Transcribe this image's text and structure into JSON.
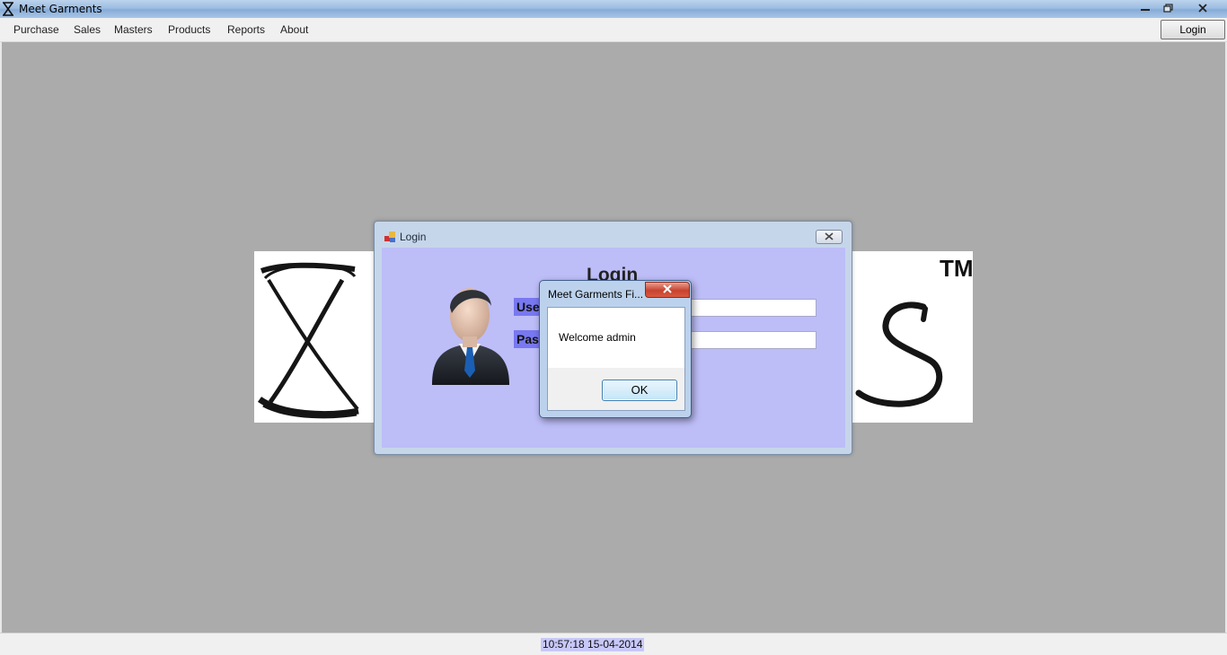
{
  "window": {
    "title": "Meet Garments",
    "icon": "hourglass-icon",
    "controls": [
      "minimize-icon",
      "restore-icon",
      "close-icon"
    ]
  },
  "menu": {
    "items": [
      {
        "label": "Purchase"
      },
      {
        "label": "Sales"
      },
      {
        "label": "Masters"
      },
      {
        "label": "Products"
      },
      {
        "label": "Reports"
      },
      {
        "label": "About"
      }
    ],
    "login_button": "Login"
  },
  "background_logo": {
    "trademark": "TM"
  },
  "login_dialog": {
    "title": "Login",
    "heading": "Login",
    "username_label": "User",
    "password_label": "Pass",
    "username_value": "",
    "password_value": ""
  },
  "message_box": {
    "title": "Meet Garments Fi...",
    "message": "Welcome admin",
    "ok_label": "OK"
  },
  "status": {
    "clock": "10:57:18 15-04-2014"
  },
  "colors": {
    "desktop": "#ababab",
    "login_client": "#bdbdf8",
    "label_bg": "#7878f0",
    "close_red": "#c8422e"
  }
}
